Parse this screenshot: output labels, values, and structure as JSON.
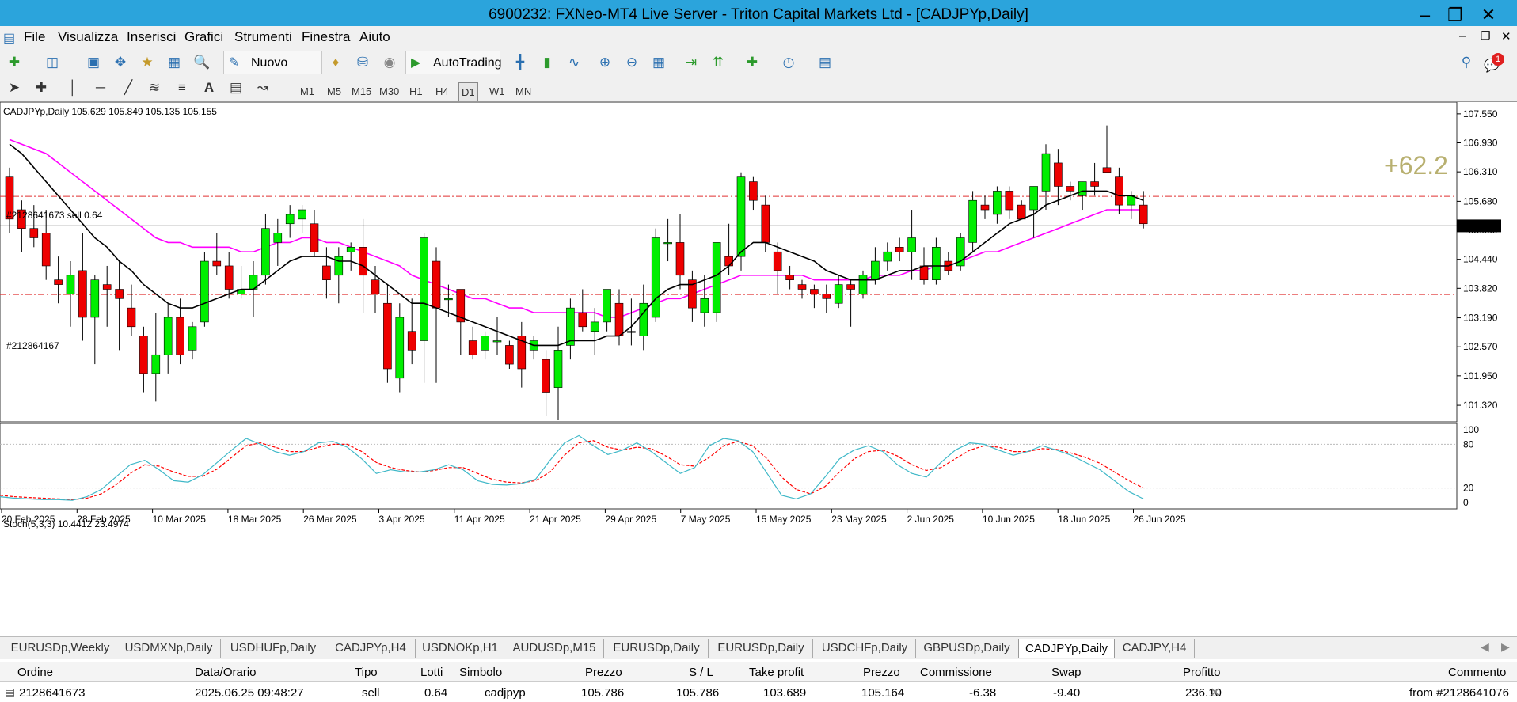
{
  "window": {
    "title": "6900232: FXNeo-MT4 Live Server - Triton Capital Markets Ltd - [CADJPYp,Daily]"
  },
  "menu": [
    "File",
    "Visualizza",
    "Inserisci",
    "Grafici",
    "Strumenti",
    "Finestra",
    "Aiuto"
  ],
  "toolbar": {
    "new_order_label": "Nuovo ordine",
    "autotrading_label": "AutoTrading",
    "notification_count": "1"
  },
  "timeframes": [
    "M1",
    "M5",
    "M15",
    "M30",
    "H1",
    "H4",
    "D1",
    "W1",
    "MN"
  ],
  "active_timeframe": "D1",
  "chart": {
    "header": "CADJPYp,Daily  105.629 105.849 105.135 105.155",
    "profit_overlay": "+62.2",
    "order_label_sell": "#2128641673 sell 0.64",
    "order_label_tp": "#212864167",
    "current_price_label": "105.155",
    "price_ticks": [
      "107.550",
      "106.930",
      "106.310",
      "105.680",
      "105.060",
      "104.440",
      "103.820",
      "103.190",
      "102.570",
      "101.950",
      "101.320"
    ],
    "date_ticks": [
      "20 Feb 2025",
      "28 Feb 2025",
      "10 Mar 2025",
      "18 Mar 2025",
      "26 Mar 2025",
      "3 Apr 2025",
      "11 Apr 2025",
      "21 Apr 2025",
      "29 Apr 2025",
      "7 May 2025",
      "15 May 2025",
      "23 May 2025",
      "2 Jun 2025",
      "10 Jun 2025",
      "18 Jun 2025",
      "26 Jun 2025"
    ],
    "colors": {
      "bull": "#00ee00",
      "bear": "#ee0000",
      "ma_fast": "#000000",
      "ma_slow": "#ff00ff",
      "stoch_main": "#3fb8c8",
      "stoch_signal": "#ff0000",
      "level_line": "#e03030"
    }
  },
  "oscillator": {
    "header": "Stoch(5,3,3) 10.4412 23.4974",
    "levels": [
      "100",
      "80",
      "20",
      "0"
    ]
  },
  "chart_data": {
    "type": "candlestick",
    "title": "CADJPYp,Daily",
    "ylim": [
      101.0,
      107.7
    ],
    "current_price": 105.155,
    "sell_entry_price": 105.786,
    "take_profit_price": 103.689,
    "candles": [
      {
        "o": 106.2,
        "h": 106.4,
        "l": 105.0,
        "c": 105.3
      },
      {
        "o": 105.5,
        "h": 105.7,
        "l": 104.6,
        "c": 105.1
      },
      {
        "o": 105.1,
        "h": 105.6,
        "l": 104.7,
        "c": 104.9
      },
      {
        "o": 105.0,
        "h": 105.5,
        "l": 104.0,
        "c": 104.3
      },
      {
        "o": 104.0,
        "h": 104.5,
        "l": 103.5,
        "c": 103.9
      },
      {
        "o": 103.7,
        "h": 104.4,
        "l": 103.0,
        "c": 104.1
      },
      {
        "o": 104.2,
        "h": 105.0,
        "l": 102.7,
        "c": 103.2
      },
      {
        "o": 103.2,
        "h": 104.1,
        "l": 102.2,
        "c": 104.0
      },
      {
        "o": 103.9,
        "h": 104.3,
        "l": 103.0,
        "c": 103.8
      },
      {
        "o": 103.8,
        "h": 104.4,
        "l": 102.5,
        "c": 103.6
      },
      {
        "o": 103.4,
        "h": 103.9,
        "l": 102.8,
        "c": 103.0
      },
      {
        "o": 102.8,
        "h": 103.0,
        "l": 101.6,
        "c": 102.0
      },
      {
        "o": 102.0,
        "h": 103.3,
        "l": 101.4,
        "c": 102.4
      },
      {
        "o": 102.4,
        "h": 103.5,
        "l": 102.0,
        "c": 103.2
      },
      {
        "o": 103.2,
        "h": 103.6,
        "l": 102.2,
        "c": 102.4
      },
      {
        "o": 102.5,
        "h": 103.1,
        "l": 102.3,
        "c": 103.0
      },
      {
        "o": 103.1,
        "h": 104.6,
        "l": 103.0,
        "c": 104.4
      },
      {
        "o": 104.4,
        "h": 105.0,
        "l": 104.1,
        "c": 104.3
      },
      {
        "o": 104.3,
        "h": 104.6,
        "l": 103.6,
        "c": 103.8
      },
      {
        "o": 103.7,
        "h": 104.3,
        "l": 103.6,
        "c": 103.8
      },
      {
        "o": 103.8,
        "h": 104.4,
        "l": 103.2,
        "c": 104.1
      },
      {
        "o": 104.1,
        "h": 105.4,
        "l": 103.9,
        "c": 105.1
      },
      {
        "o": 104.8,
        "h": 105.3,
        "l": 104.3,
        "c": 105.0
      },
      {
        "o": 105.2,
        "h": 105.6,
        "l": 104.9,
        "c": 105.4
      },
      {
        "o": 105.3,
        "h": 105.6,
        "l": 105.0,
        "c": 105.5
      },
      {
        "o": 105.2,
        "h": 105.5,
        "l": 104.5,
        "c": 104.6
      },
      {
        "o": 104.3,
        "h": 104.7,
        "l": 103.6,
        "c": 104.0
      },
      {
        "o": 104.1,
        "h": 104.7,
        "l": 103.5,
        "c": 104.5
      },
      {
        "o": 104.6,
        "h": 104.8,
        "l": 104.2,
        "c": 104.7
      },
      {
        "o": 104.7,
        "h": 105.3,
        "l": 103.3,
        "c": 104.1
      },
      {
        "o": 104.0,
        "h": 104.3,
        "l": 103.3,
        "c": 103.7
      },
      {
        "o": 103.5,
        "h": 103.9,
        "l": 101.8,
        "c": 102.1
      },
      {
        "o": 101.9,
        "h": 103.5,
        "l": 101.6,
        "c": 103.2
      },
      {
        "o": 102.9,
        "h": 103.6,
        "l": 102.2,
        "c": 102.5
      },
      {
        "o": 102.7,
        "h": 105.0,
        "l": 101.8,
        "c": 104.9
      },
      {
        "o": 104.4,
        "h": 104.7,
        "l": 101.8,
        "c": 103.4
      },
      {
        "o": 103.6,
        "h": 103.9,
        "l": 103.2,
        "c": 103.6
      },
      {
        "o": 103.8,
        "h": 103.8,
        "l": 102.4,
        "c": 103.1
      },
      {
        "o": 102.7,
        "h": 103.0,
        "l": 102.3,
        "c": 102.4
      },
      {
        "o": 102.5,
        "h": 102.9,
        "l": 102.3,
        "c": 102.8
      },
      {
        "o": 102.7,
        "h": 103.2,
        "l": 102.4,
        "c": 102.7
      },
      {
        "o": 102.6,
        "h": 102.7,
        "l": 102.1,
        "c": 102.2
      },
      {
        "o": 102.8,
        "h": 103.1,
        "l": 101.7,
        "c": 102.1
      },
      {
        "o": 102.5,
        "h": 102.8,
        "l": 102.3,
        "c": 102.7
      },
      {
        "o": 102.3,
        "h": 102.5,
        "l": 101.1,
        "c": 101.6
      },
      {
        "o": 101.7,
        "h": 103.0,
        "l": 101.0,
        "c": 102.5
      },
      {
        "o": 102.6,
        "h": 103.6,
        "l": 102.3,
        "c": 103.4
      },
      {
        "o": 103.3,
        "h": 103.8,
        "l": 102.9,
        "c": 103.0
      },
      {
        "o": 102.9,
        "h": 103.4,
        "l": 102.4,
        "c": 103.1
      },
      {
        "o": 103.1,
        "h": 103.6,
        "l": 102.9,
        "c": 103.8
      },
      {
        "o": 103.5,
        "h": 103.8,
        "l": 102.6,
        "c": 102.8
      },
      {
        "o": 102.9,
        "h": 103.6,
        "l": 102.6,
        "c": 102.9
      },
      {
        "o": 102.8,
        "h": 103.9,
        "l": 102.5,
        "c": 103.5
      },
      {
        "o": 103.2,
        "h": 105.1,
        "l": 103.1,
        "c": 104.9
      },
      {
        "o": 104.8,
        "h": 105.3,
        "l": 104.4,
        "c": 104.8
      },
      {
        "o": 104.8,
        "h": 105.4,
        "l": 103.8,
        "c": 104.1
      },
      {
        "o": 104.0,
        "h": 104.2,
        "l": 103.1,
        "c": 103.4
      },
      {
        "o": 103.3,
        "h": 104.1,
        "l": 103.0,
        "c": 103.6
      },
      {
        "o": 103.3,
        "h": 104.5,
        "l": 103.1,
        "c": 104.8
      },
      {
        "o": 104.5,
        "h": 105.2,
        "l": 104.1,
        "c": 104.3
      },
      {
        "o": 104.5,
        "h": 106.3,
        "l": 104.2,
        "c": 106.2
      },
      {
        "o": 106.1,
        "h": 106.2,
        "l": 105.5,
        "c": 105.7
      },
      {
        "o": 105.6,
        "h": 105.8,
        "l": 104.6,
        "c": 104.8
      },
      {
        "o": 104.6,
        "h": 104.8,
        "l": 103.7,
        "c": 104.2
      },
      {
        "o": 104.1,
        "h": 104.3,
        "l": 103.8,
        "c": 104.0
      },
      {
        "o": 103.9,
        "h": 104.0,
        "l": 103.6,
        "c": 103.8
      },
      {
        "o": 103.8,
        "h": 103.9,
        "l": 103.4,
        "c": 103.7
      },
      {
        "o": 103.7,
        "h": 103.9,
        "l": 103.3,
        "c": 103.6
      },
      {
        "o": 103.5,
        "h": 104.1,
        "l": 103.4,
        "c": 103.9
      },
      {
        "o": 103.9,
        "h": 104.0,
        "l": 103.0,
        "c": 103.8
      },
      {
        "o": 103.7,
        "h": 104.2,
        "l": 103.6,
        "c": 104.1
      },
      {
        "o": 104.0,
        "h": 104.7,
        "l": 103.9,
        "c": 104.4
      },
      {
        "o": 104.4,
        "h": 104.8,
        "l": 104.2,
        "c": 104.6
      },
      {
        "o": 104.7,
        "h": 104.9,
        "l": 104.4,
        "c": 104.6
      },
      {
        "o": 104.6,
        "h": 105.5,
        "l": 104.0,
        "c": 104.9
      },
      {
        "o": 104.3,
        "h": 104.7,
        "l": 103.9,
        "c": 104.0
      },
      {
        "o": 104.0,
        "h": 104.9,
        "l": 103.9,
        "c": 104.7
      },
      {
        "o": 104.4,
        "h": 104.6,
        "l": 104.1,
        "c": 104.2
      },
      {
        "o": 104.3,
        "h": 105.0,
        "l": 104.2,
        "c": 104.9
      },
      {
        "o": 104.8,
        "h": 105.9,
        "l": 104.6,
        "c": 105.7
      },
      {
        "o": 105.6,
        "h": 105.8,
        "l": 105.3,
        "c": 105.5
      },
      {
        "o": 105.4,
        "h": 106.0,
        "l": 105.2,
        "c": 105.9
      },
      {
        "o": 105.9,
        "h": 106.0,
        "l": 105.3,
        "c": 105.5
      },
      {
        "o": 105.6,
        "h": 105.7,
        "l": 105.3,
        "c": 105.3
      },
      {
        "o": 105.5,
        "h": 106.0,
        "l": 104.9,
        "c": 106.0
      },
      {
        "o": 105.9,
        "h": 106.9,
        "l": 105.5,
        "c": 106.7
      },
      {
        "o": 106.5,
        "h": 106.8,
        "l": 105.6,
        "c": 106.0
      },
      {
        "o": 106.0,
        "h": 106.1,
        "l": 105.7,
        "c": 105.9
      },
      {
        "o": 105.8,
        "h": 106.1,
        "l": 105.5,
        "c": 106.1
      },
      {
        "o": 106.1,
        "h": 106.5,
        "l": 105.8,
        "c": 106.0
      },
      {
        "o": 106.4,
        "h": 107.3,
        "l": 106.3,
        "c": 106.3
      },
      {
        "o": 106.2,
        "h": 106.4,
        "l": 105.4,
        "c": 105.6
      },
      {
        "o": 105.6,
        "h": 105.9,
        "l": 105.3,
        "c": 105.8
      },
      {
        "o": 105.6,
        "h": 105.9,
        "l": 105.1,
        "c": 105.2
      }
    ],
    "ma_fast": [
      106.9,
      106.7,
      106.4,
      106.1,
      105.8,
      105.5,
      105.2,
      104.9,
      104.7,
      104.4,
      104.2,
      103.9,
      103.7,
      103.5,
      103.4,
      103.4,
      103.5,
      103.6,
      103.7,
      103.8,
      103.8,
      104.0,
      104.2,
      104.4,
      104.5,
      104.5,
      104.5,
      104.4,
      104.4,
      104.3,
      104.1,
      103.9,
      103.7,
      103.5,
      103.5,
      103.4,
      103.3,
      103.2,
      103.1,
      103.0,
      102.9,
      102.8,
      102.7,
      102.6,
      102.6,
      102.6,
      102.7,
      102.7,
      102.7,
      102.8,
      102.8,
      103.0,
      103.3,
      103.6,
      103.8,
      103.9,
      103.9,
      104.0,
      104.1,
      104.3,
      104.6,
      104.8,
      104.8,
      104.7,
      104.6,
      104.5,
      104.4,
      104.2,
      104.1,
      104.0,
      104.0,
      104.0,
      104.1,
      104.2,
      104.2,
      104.3,
      104.3,
      104.3,
      104.4,
      104.6,
      104.8,
      105.0,
      105.2,
      105.3,
      105.4,
      105.6,
      105.7,
      105.8,
      105.9,
      105.9,
      105.9,
      105.8,
      105.8,
      105.7
    ],
    "ma_slow": [
      107.0,
      106.9,
      106.8,
      106.7,
      106.5,
      106.3,
      106.1,
      105.9,
      105.7,
      105.5,
      105.3,
      105.1,
      104.9,
      104.8,
      104.8,
      104.7,
      104.7,
      104.7,
      104.7,
      104.6,
      104.6,
      104.7,
      104.8,
      104.8,
      104.9,
      104.9,
      104.8,
      104.8,
      104.7,
      104.6,
      104.5,
      104.4,
      104.3,
      104.1,
      104.0,
      103.9,
      103.8,
      103.7,
      103.6,
      103.6,
      103.5,
      103.4,
      103.4,
      103.3,
      103.3,
      103.3,
      103.3,
      103.3,
      103.3,
      103.2,
      103.2,
      103.3,
      103.4,
      103.5,
      103.6,
      103.6,
      103.7,
      103.8,
      103.9,
      104.0,
      104.1,
      104.1,
      104.1,
      104.1,
      104.1,
      104.1,
      104.0,
      104.0,
      104.0,
      104.0,
      104.0,
      104.1,
      104.1,
      104.1,
      104.2,
      104.2,
      104.3,
      104.3,
      104.4,
      104.5,
      104.6,
      104.6,
      104.7,
      104.8,
      104.9,
      105.0,
      105.1,
      105.2,
      105.3,
      105.4,
      105.5,
      105.5,
      105.5,
      105.5
    ],
    "stoch_main": [
      8,
      6,
      5,
      4,
      4,
      3,
      8,
      18,
      35,
      52,
      58,
      45,
      30,
      28,
      38,
      55,
      72,
      88,
      80,
      70,
      65,
      70,
      82,
      84,
      76,
      60,
      40,
      45,
      42,
      42,
      45,
      52,
      45,
      30,
      25,
      24,
      26,
      32,
      58,
      82,
      92,
      78,
      66,
      72,
      82,
      70,
      55,
      40,
      48,
      78,
      88,
      85,
      70,
      40,
      10,
      5,
      12,
      35,
      60,
      72,
      78,
      70,
      52,
      40,
      35,
      55,
      72,
      82,
      80,
      72,
      65,
      70,
      78,
      72,
      65,
      55,
      45,
      30,
      15,
      5
    ],
    "stoch_signal": [
      10,
      8,
      7,
      6,
      5,
      4,
      6,
      12,
      24,
      40,
      52,
      50,
      42,
      36,
      36,
      46,
      62,
      78,
      82,
      76,
      70,
      70,
      76,
      80,
      80,
      70,
      55,
      48,
      44,
      42,
      44,
      48,
      48,
      40,
      32,
      28,
      27,
      30,
      42,
      65,
      82,
      85,
      76,
      72,
      76,
      74,
      64,
      52,
      50,
      62,
      78,
      84,
      78,
      60,
      35,
      18,
      12,
      22,
      42,
      60,
      70,
      72,
      64,
      52,
      44,
      48,
      60,
      72,
      78,
      76,
      70,
      70,
      74,
      73,
      68,
      62,
      54,
      42,
      30,
      20
    ],
    "stoch_level_high": 80,
    "stoch_level_low": 20,
    "stoch_ylim": [
      0,
      100
    ]
  },
  "tabs": [
    "EURUSDp,Weekly",
    "USDMXNp,Daily",
    "USDHUFp,Daily",
    "CADJPYp,H4",
    "USDNOKp,H1",
    "AUDUSDp,M15",
    "EURUSDp,Daily",
    "EURUSDp,Daily",
    "USDCHFp,Daily",
    "GBPUSDp,Daily",
    "CADJPYp,Daily",
    "CADJPY,H4"
  ],
  "active_tab": 10,
  "terminal": {
    "headers": [
      "Ordine",
      "Data/Orario",
      "Tipo",
      "Lotti",
      "Simbolo",
      "Prezzo",
      "S / L",
      "Take profit",
      "Prezzo",
      "Commissione",
      "Swap",
      "Profitto",
      "Commento"
    ],
    "row": [
      "2128641673",
      "2025.06.25 09:48:27",
      "sell",
      "0.64",
      "cadjpyp",
      "105.786",
      "105.786",
      "103.689",
      "105.164",
      "-6.38",
      "-9.40",
      "236.10",
      "from #2128641076"
    ]
  }
}
